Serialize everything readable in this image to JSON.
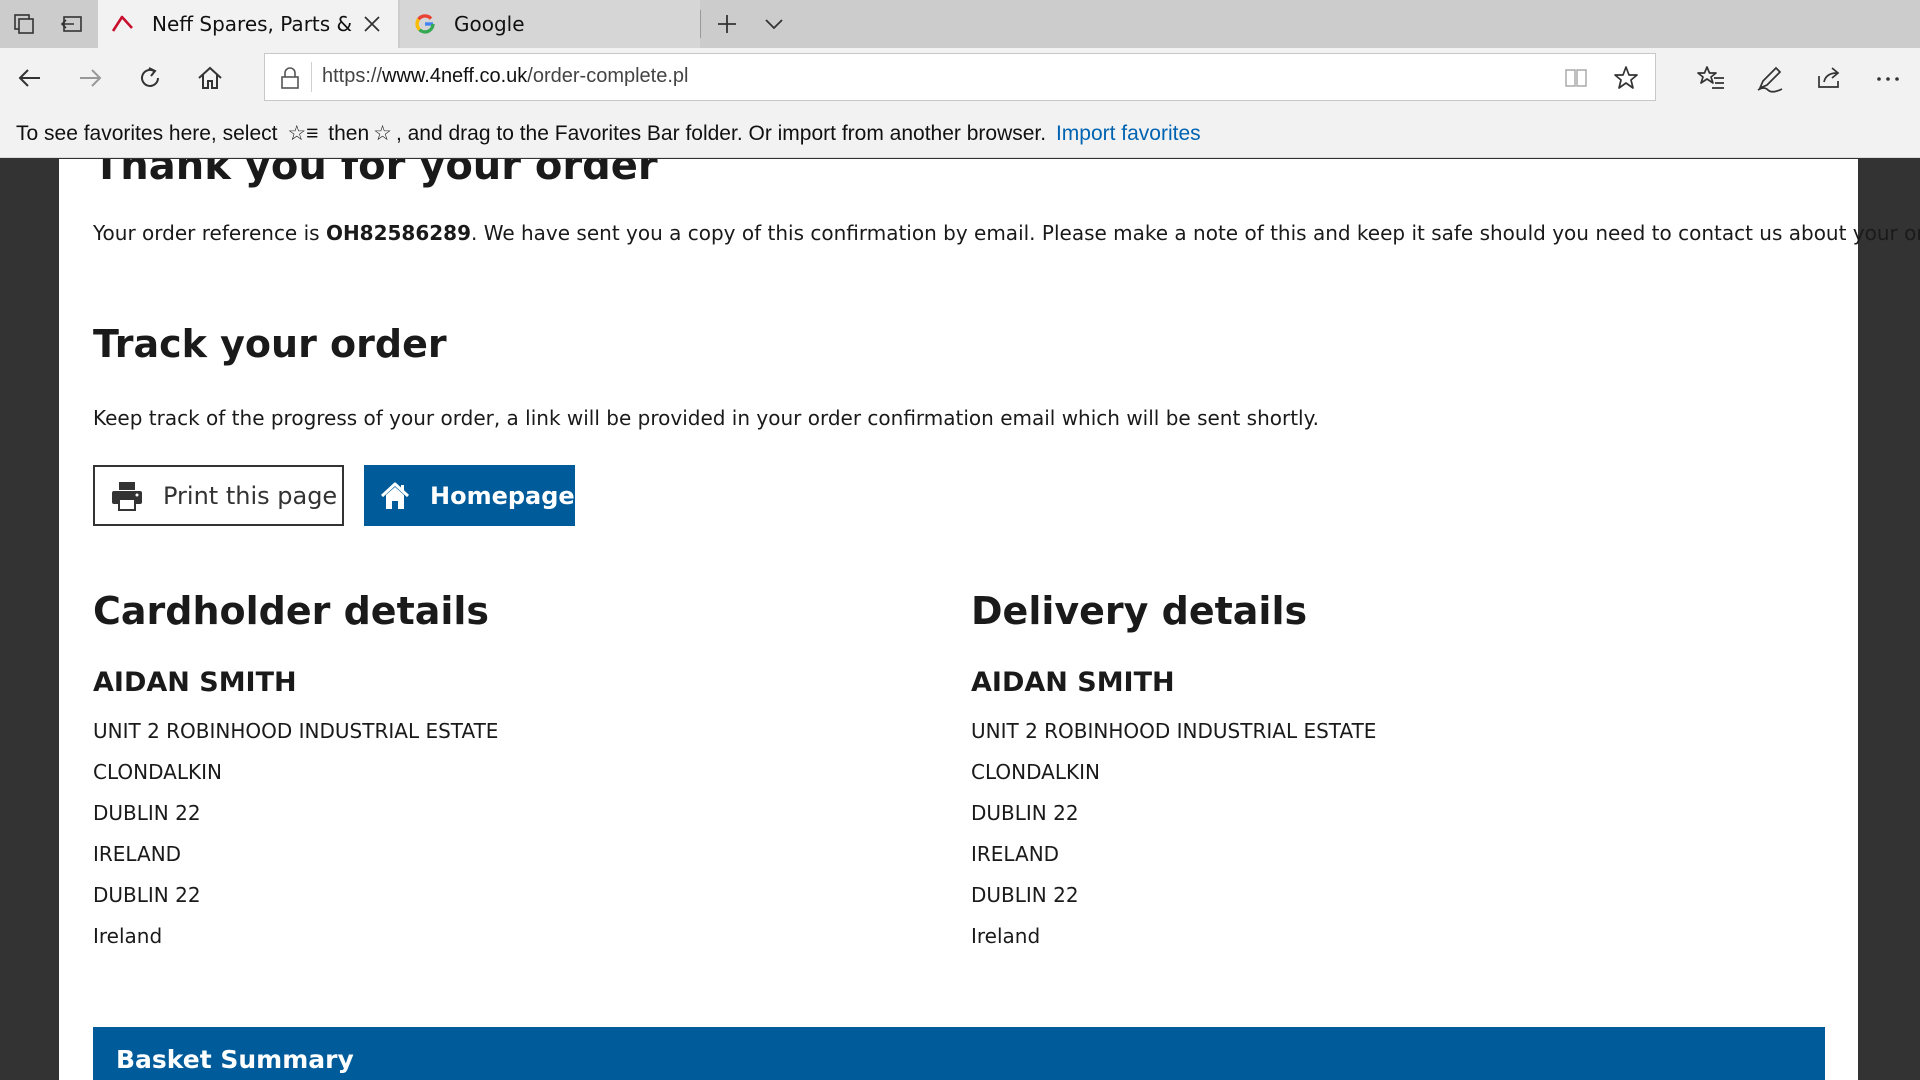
{
  "browser": {
    "tabs": [
      {
        "title": "Neff Spares, Parts & Acc",
        "active": true
      },
      {
        "title": "Google",
        "active": false
      }
    ],
    "url": {
      "prefix": "https://",
      "host": "www.4neff.co.uk",
      "path": "/order-complete.pl"
    },
    "favorites_bar": {
      "message_part1": "To see favorites here, select",
      "message_part2": "then",
      "message_part3": ", and drag to the Favorites Bar folder. Or import from another browser.",
      "import_link": "Import favorites"
    }
  },
  "page": {
    "heading": "Thank you for your order",
    "intro_prefix": "Your order reference is ",
    "order_reference": "OH82586289",
    "intro_suffix": ". We have sent you a copy of this confirmation by email. Please make a note of this and keep it safe should you need to contact us about your order.",
    "track_heading": "Track your order",
    "track_text": "Keep track of the progress of your order, a link will be provided in your order confirmation email which will be sent shortly.",
    "print_button": "Print this page",
    "home_button": "Homepage",
    "cardholder": {
      "heading": "Cardholder details",
      "name": "AIDAN SMITH",
      "lines": [
        "UNIT 2 ROBINHOOD INDUSTRIAL ESTATE",
        "CLONDALKIN",
        "DUBLIN 22",
        "IRELAND",
        "DUBLIN 22",
        "Ireland"
      ]
    },
    "delivery": {
      "heading": "Delivery details",
      "name": "AIDAN SMITH",
      "lines": [
        "UNIT 2 ROBINHOOD INDUSTRIAL ESTATE",
        "CLONDALKIN",
        "DUBLIN 22",
        "IRELAND",
        "DUBLIN 22",
        "Ireland"
      ]
    },
    "basket_title": "Basket Summary"
  },
  "colors": {
    "brand_blue": "#005b9a",
    "link_blue": "#0063b1"
  }
}
